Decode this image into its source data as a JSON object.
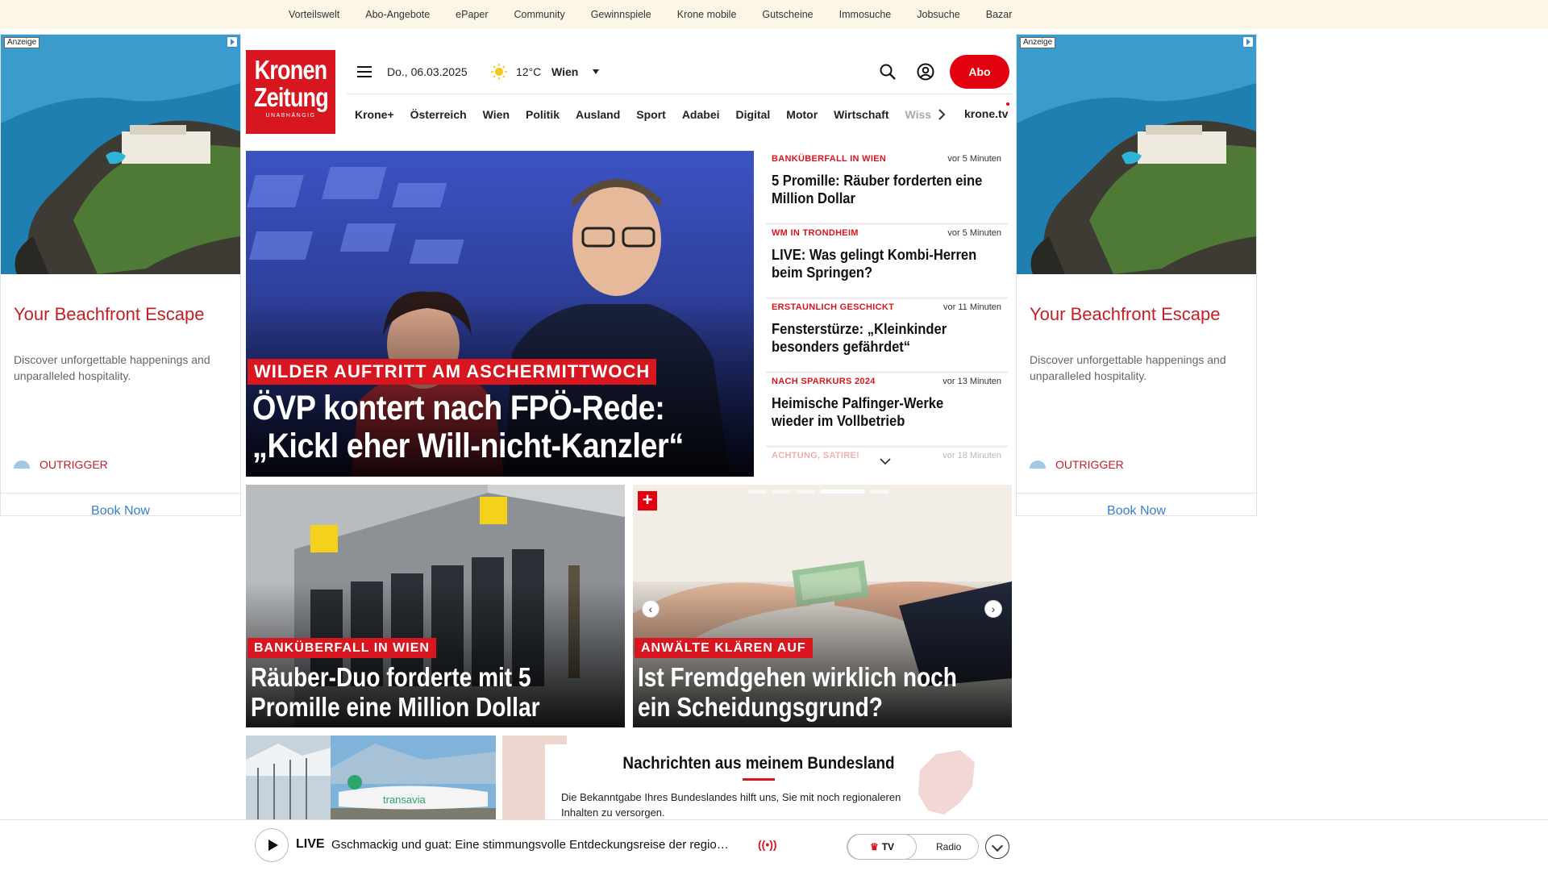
{
  "topbar": {
    "links": [
      "Vorteilswelt",
      "Abo-Angebote",
      "ePaper",
      "Community",
      "Gewinnspiele",
      "Krone mobile",
      "Gutscheine",
      "Immosuche",
      "Jobsuche",
      "Bazar"
    ]
  },
  "ad": {
    "label": "Anzeige",
    "headline": "Your Beachfront Escape",
    "description": "Discover unforgettable happenings and unparalleled hospitality.",
    "brand": "OUTRIGGER",
    "cta": "Book Now"
  },
  "header": {
    "logo_line1": "Kronen",
    "logo_line2": "Zeitung",
    "logo_tag": "UNABHÄNGIG",
    "date": "Do., 06.03.2025",
    "temperature": "12°C",
    "city": "Wien",
    "abo_label": "Abo",
    "icons": {
      "menu": "hamburger-icon",
      "weather": "sun-icon",
      "search": "search-icon",
      "account": "user-icon"
    }
  },
  "nav": {
    "items": [
      "Krone+",
      "Österreich",
      "Wien",
      "Politik",
      "Ausland",
      "Sport",
      "Adabei",
      "Digital",
      "Motor",
      "Wirtschaft"
    ],
    "truncated_item": "Wiss",
    "tv_label": "krone.tv"
  },
  "hero": {
    "kicker": "WILDER AUFTRITT AM ASCHERMITTWOCH",
    "title": "ÖVP kontert nach FPÖ-Rede: „Kickl eher Will-nicht-Kanzler“"
  },
  "news_list": [
    {
      "kicker": "BANKÜBERFALL IN WIEN",
      "time": "vor 5 Minuten",
      "headline": "5 Promille: Räuber forderten eine Million Dollar"
    },
    {
      "kicker": "WM IN TRONDHEIM",
      "time": "vor 5 Minuten",
      "headline": "LIVE: Was gelingt Kombi-Herren beim Springen?"
    },
    {
      "kicker": "ERSTAUNLICH GESCHICKT",
      "time": "vor 11 Minuten",
      "headline": "Fensterstürze: „Kleinkinder besonders gefährdet“"
    },
    {
      "kicker": "NACH SPARKURS 2024",
      "time": "vor 13 Minuten",
      "headline": "Heimische Palfinger-Werke wieder im Vollbetrieb"
    },
    {
      "kicker": "ACHTUNG, SATIRE!",
      "time": "vor 18 Minuten",
      "headline": ""
    }
  ],
  "teasers": [
    {
      "kicker": "BANKÜBERFALL IN WIEN",
      "title": "Räuber-Duo forderte mit 5 Promille eine Million Dollar"
    },
    {
      "kicker": "ANWÄLTE KLÄREN AUF",
      "title": "Ist Fremdgehen wirklich noch ein Scheidungsgrund?",
      "plus": "+"
    }
  ],
  "bundesland": {
    "title": "Nachrichten aus meinem Bundesland",
    "text": "Die Bekanntgabe Ihres Bundeslandes hilft uns, Sie mit noch regionaleren Inhalten zu versorgen."
  },
  "live_player": {
    "label": "LIVE",
    "text": "Gschmackig und guat: Eine stimmungsvolle Entdeckungsreise der regio…",
    "wave": "((•))",
    "tv": "TV",
    "radio": "Radio"
  },
  "colors": {
    "brand_red": "#d8161f",
    "topbar_bg": "#fbf6e6",
    "ad_link": "#3a7ed0"
  }
}
